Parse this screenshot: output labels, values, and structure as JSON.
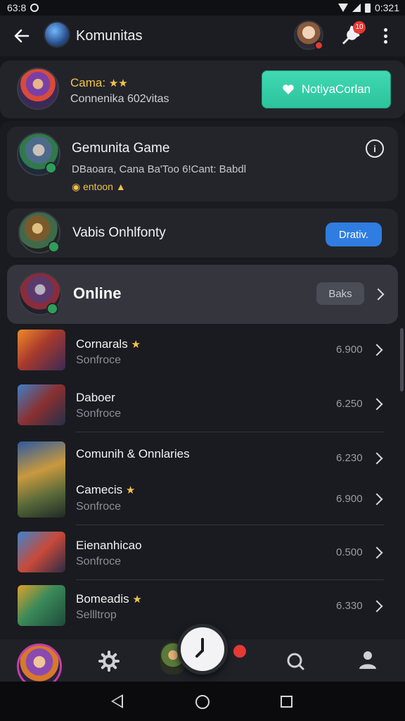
{
  "status_bar": {
    "time_left": "63:8",
    "time_right": "0:321"
  },
  "app_bar": {
    "title": "Komunitas",
    "tool_badge": "10"
  },
  "hero": {
    "title": "Camа:",
    "subtitle": "Connenika 602vitas",
    "notify_button": "NotiyaCorlan"
  },
  "info_card": {
    "title": "Gemunita Game",
    "description": "DBaoara, Cana Ba'Too 6!Cant: Babdl",
    "tag": "entoon"
  },
  "vab_card": {
    "title": "Vabis Onhlfonty",
    "button": "Drativ."
  },
  "online": {
    "title": "Online",
    "chip": "Baks"
  },
  "rows": [
    {
      "title": "Cornarals",
      "subtitle": "Sonfroce",
      "value": "6.900",
      "star": true
    },
    {
      "title": "Daboer",
      "subtitle": "Sonfroce",
      "value": "6.250",
      "star": false
    },
    {
      "title": "Comunih & Onnlaries",
      "subtitle": "",
      "value": "6.230",
      "star": false
    },
    {
      "title": "Camecis",
      "subtitle": "Sonfroce",
      "value": "6.900",
      "star": true
    },
    {
      "title": "Eienanhicao",
      "subtitle": "Sonfroce",
      "value": "0.500",
      "star": false
    },
    {
      "title": "Bomeadis",
      "subtitle": "Sellltrop",
      "value": "6.330",
      "star": true
    }
  ],
  "icons": {
    "back": "arrow-left-icon",
    "more": "more-vertical-icon",
    "tool": "wrench-icon",
    "info": "info-icon",
    "chevron": "chevron-right-icon",
    "gear": "gear-icon",
    "search": "search-icon",
    "person": "person-icon",
    "clock": "clock-icon",
    "heart": "heart-icon"
  },
  "colors": {
    "accent_teal": "#2cc39c",
    "accent_blue": "#2f7de1",
    "gold": "#f3c44a",
    "badge_red": "#e53935"
  }
}
